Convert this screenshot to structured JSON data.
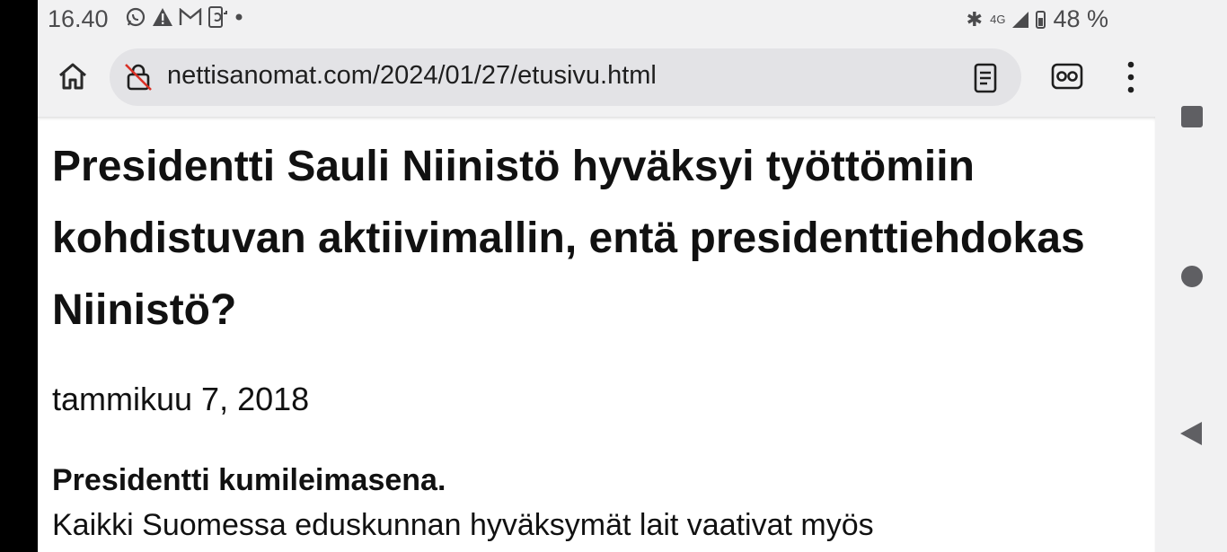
{
  "status_bar": {
    "time": "16.40",
    "left_icons": [
      "whatsapp-icon",
      "warning-icon",
      "gmail-icon",
      "phone-sync-icon",
      "dot-icon"
    ],
    "network": "4G",
    "battery": "48 %"
  },
  "browser": {
    "url": "nettisanomat.com/2024/01/27/etusivu.html",
    "icons": [
      "home-icon",
      "not-secure-icon",
      "reader-mode-icon",
      "incognito-glasses-icon",
      "more-vert-icon"
    ]
  },
  "article": {
    "headline": "Presidentti Sauli Niinistö hyväksyi työttömiin kohdistuvan aktiivimallin, entä presidenttiehdokas Niinistö?",
    "date": "tammikuu 7, 2018",
    "lead": "Presidentti kumileimasena.",
    "body_first_line": "Kaikki Suomessa eduskunnan hyväksymät lait vaativat myös"
  },
  "colors": {
    "page_bg": "#ffffff",
    "chrome_bg": "#f1f1f2",
    "urlbar_bg": "#e3e3e6",
    "nav_icon": "#5f5f63"
  }
}
